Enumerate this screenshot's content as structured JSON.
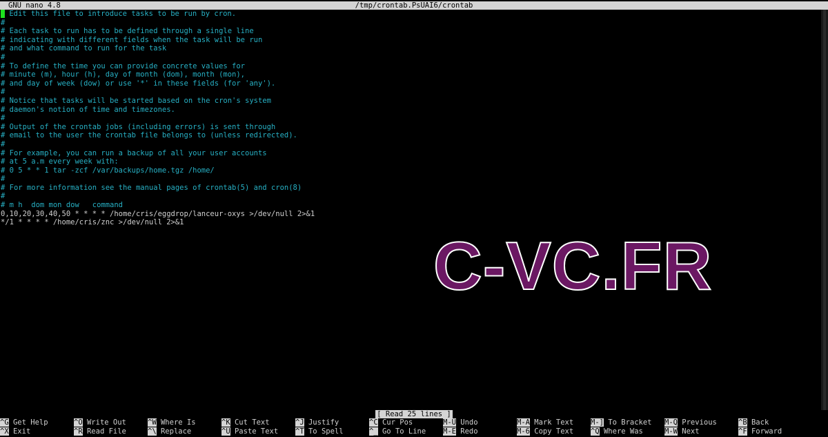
{
  "titlebar": {
    "app": "GNU nano 4.8",
    "file": "/tmp/crontab.PsUAI6/crontab"
  },
  "lines": [
    {
      "text": "# Edit this file to introduce tasks to be run by cron.",
      "type": "comment"
    },
    {
      "text": "#",
      "type": "comment"
    },
    {
      "text": "# Each task to run has to be defined through a single line",
      "type": "comment"
    },
    {
      "text": "# indicating with different fields when the task will be run",
      "type": "comment"
    },
    {
      "text": "# and what command to run for the task",
      "type": "comment"
    },
    {
      "text": "#",
      "type": "comment"
    },
    {
      "text": "# To define the time you can provide concrete values for",
      "type": "comment"
    },
    {
      "text": "# minute (m), hour (h), day of month (dom), month (mon),",
      "type": "comment"
    },
    {
      "text": "# and day of week (dow) or use '*' in these fields (for 'any').",
      "type": "comment"
    },
    {
      "text": "#",
      "type": "comment"
    },
    {
      "text": "# Notice that tasks will be started based on the cron's system",
      "type": "comment"
    },
    {
      "text": "# daemon's notion of time and timezones.",
      "type": "comment"
    },
    {
      "text": "#",
      "type": "comment"
    },
    {
      "text": "# Output of the crontab jobs (including errors) is sent through",
      "type": "comment"
    },
    {
      "text": "# email to the user the crontab file belongs to (unless redirected).",
      "type": "comment"
    },
    {
      "text": "#",
      "type": "comment"
    },
    {
      "text": "# For example, you can run a backup of all your user accounts",
      "type": "comment"
    },
    {
      "text": "# at 5 a.m every week with:",
      "type": "comment"
    },
    {
      "text": "# 0 5 * * 1 tar -zcf /var/backups/home.tgz /home/",
      "type": "comment"
    },
    {
      "text": "#",
      "type": "comment"
    },
    {
      "text": "# For more information see the manual pages of crontab(5) and cron(8)",
      "type": "comment"
    },
    {
      "text": "#",
      "type": "comment"
    },
    {
      "text": "# m h  dom mon dow   command",
      "type": "comment"
    },
    {
      "text": "0,10,20,30,40,50 * * * * /home/cris/eggdrop/lanceur-oxys >/dev/null 2>&1",
      "type": "plain"
    },
    {
      "text": "*/1 * * * * /home/cris/znc >/dev/null 2>&1",
      "type": "plain"
    }
  ],
  "status": "[ Read 25 lines ]",
  "watermark": "C-VC.FR",
  "shortcuts": [
    {
      "key": "^G",
      "label": "Get Help",
      "name": "get-help"
    },
    {
      "key": "^O",
      "label": "Write Out",
      "name": "write-out"
    },
    {
      "key": "^W",
      "label": "Where Is",
      "name": "where-is"
    },
    {
      "key": "^K",
      "label": "Cut Text",
      "name": "cut-text"
    },
    {
      "key": "^J",
      "label": "Justify",
      "name": "justify"
    },
    {
      "key": "^C",
      "label": "Cur Pos",
      "name": "cur-pos"
    },
    {
      "key": "M-U",
      "label": "Undo",
      "name": "undo"
    },
    {
      "key": "M-A",
      "label": "Mark Text",
      "name": "mark-text"
    },
    {
      "key": "M-]",
      "label": "To Bracket",
      "name": "to-bracket"
    },
    {
      "key": "M-Q",
      "label": "Previous",
      "name": "previous"
    },
    {
      "key": "^B",
      "label": "Back",
      "name": "back"
    },
    {
      "key": "^X",
      "label": "Exit",
      "name": "exit"
    },
    {
      "key": "^R",
      "label": "Read File",
      "name": "read-file"
    },
    {
      "key": "^\\",
      "label": "Replace",
      "name": "replace"
    },
    {
      "key": "^U",
      "label": "Paste Text",
      "name": "paste-text"
    },
    {
      "key": "^T",
      "label": "To Spell",
      "name": "to-spell"
    },
    {
      "key": "^_",
      "label": "Go To Line",
      "name": "go-to-line"
    },
    {
      "key": "M-E",
      "label": "Redo",
      "name": "redo"
    },
    {
      "key": "M-6",
      "label": "Copy Text",
      "name": "copy-text"
    },
    {
      "key": "^Q",
      "label": "Where Was",
      "name": "where-was"
    },
    {
      "key": "M-W",
      "label": "Next",
      "name": "next"
    },
    {
      "key": "^F",
      "label": "Forward",
      "name": "forward"
    }
  ]
}
